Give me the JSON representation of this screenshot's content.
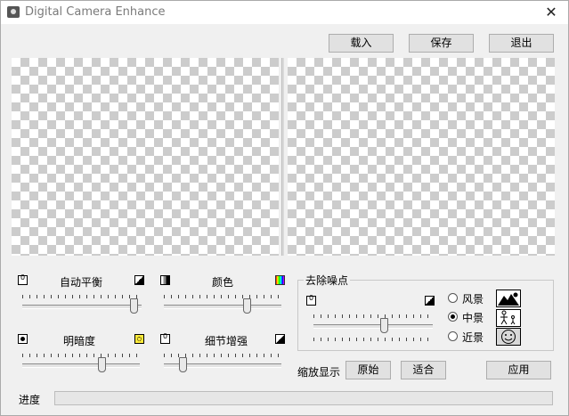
{
  "window": {
    "title": "Digital Camera Enhance",
    "close_glyph": "✕"
  },
  "toolbar": {
    "load": "载入",
    "save": "保存",
    "exit": "退出"
  },
  "adjust": {
    "white_balance": {
      "label": "自动平衡",
      "value": 0.97
    },
    "color": {
      "label": "颜色",
      "value": 0.72
    },
    "brightness": {
      "label": "明暗度",
      "value": 0.69
    },
    "detail": {
      "label": "细节增强",
      "value": 0.14
    }
  },
  "denoise": {
    "title": "去除噪点",
    "value": 0.6,
    "scenes": [
      {
        "label": "风景",
        "icon": "landscape-icon",
        "selected": false
      },
      {
        "label": "中景",
        "icon": "people-icon",
        "selected": true
      },
      {
        "label": "近景",
        "icon": "face-icon",
        "selected": false
      }
    ]
  },
  "zoom": {
    "label": "缩放显示",
    "original": "原始",
    "fit": "适合"
  },
  "apply": "应用",
  "progress": {
    "label": "进度",
    "value": 0
  }
}
